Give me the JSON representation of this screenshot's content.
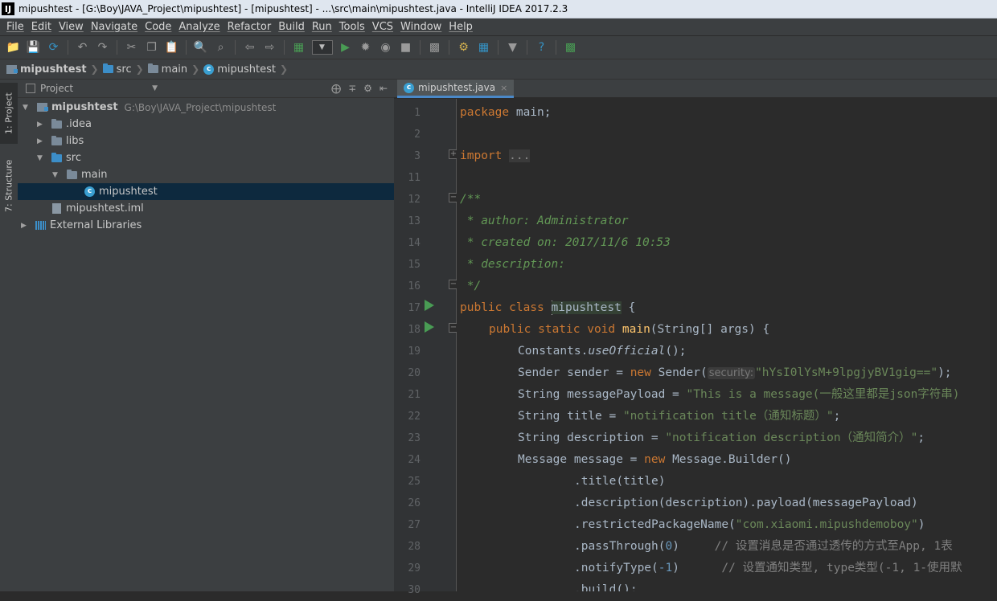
{
  "window": {
    "app_icon": "IJ",
    "title": "mipushtest - [G:\\Boy\\JAVA_Project\\mipushtest] - [mipushtest] - ...\\src\\main\\mipushtest.java - IntelliJ IDEA 2017.2.3"
  },
  "menu": [
    "File",
    "Edit",
    "View",
    "Navigate",
    "Code",
    "Analyze",
    "Refactor",
    "Build",
    "Run",
    "Tools",
    "VCS",
    "Window",
    "Help"
  ],
  "breadcrumb": [
    "mipushtest",
    "src",
    "main",
    "mipushtest"
  ],
  "side_tabs": {
    "project": "1: Project",
    "structure": "7: Structure"
  },
  "project_panel": {
    "title": "Project",
    "tree": [
      {
        "label": "mipushtest",
        "path": "G:\\Boy\\JAVA_Project\\mipushtest"
      },
      {
        "label": ".idea"
      },
      {
        "label": "libs"
      },
      {
        "label": "src"
      },
      {
        "label": "main"
      },
      {
        "label": "mipushtest"
      },
      {
        "label": "mipushtest.iml"
      },
      {
        "label": "External Libraries"
      }
    ]
  },
  "editor": {
    "tab": "mipushtest.java",
    "line_numbers": [
      "1",
      "2",
      "3",
      "11",
      "12",
      "13",
      "14",
      "15",
      "16",
      "17",
      "18",
      "19",
      "20",
      "21",
      "22",
      "23",
      "24",
      "25",
      "26",
      "27",
      "28",
      "29",
      "30"
    ],
    "code": {
      "l1_kw": "package",
      "l1_rest": " main;",
      "l3_kw": "import",
      "l3_fold": "...",
      "l12": "/**",
      "l13": " * author: Administrator",
      "l14": " * created on: 2017/11/6 10:53",
      "l15": " * description:",
      "l16": " */",
      "l17_kw": "public class ",
      "l17_name": "mipushtest",
      "l17_rest": " {",
      "l18_kw": "public static void ",
      "l18_fn": "main",
      "l18_rest": "(String[] args) {",
      "l19_a": "Constants.",
      "l19_b": "useOfficial",
      "l19_c": "();",
      "l20_a": "Sender sender = ",
      "l20_kw": "new",
      "l20_b": " Sender(",
      "l20_hint": "security:",
      "l20_str": "\"hYsI0lYsM+9lpgjyBV1gig==\"",
      "l20_c": ");",
      "l21_a": "String messagePayload = ",
      "l21_str": "\"This is a message(一般这里都是json字符串)",
      "l22_a": "String title = ",
      "l22_str": "\"notification title（通知标题）\"",
      "l22_c": ";",
      "l23_a": "String description = ",
      "l23_str": "\"notification description（通知简介）\"",
      "l23_c": ";",
      "l24_a": "Message message = ",
      "l24_kw": "new",
      "l24_b": " Message.Builder()",
      "l25": ".title(title)",
      "l26": ".description(description).payload(messagePayload)",
      "l27_a": ".restrictedPackageName(",
      "l27_str": "\"com.xiaomi.mipushdemoboy\"",
      "l27_b": ")",
      "l28_a": ".passThrough(",
      "l28_num": "0",
      "l28_b": ")",
      "l28_cmt": "// 设置消息是否通过透传的方式至App, 1表",
      "l29_a": ".notifyType(",
      "l29_num": "-1",
      "l29_b": ")",
      "l29_cmt": "// 设置通知类型, type类型(-1, 1-使用默",
      "l30": ".build();"
    }
  }
}
